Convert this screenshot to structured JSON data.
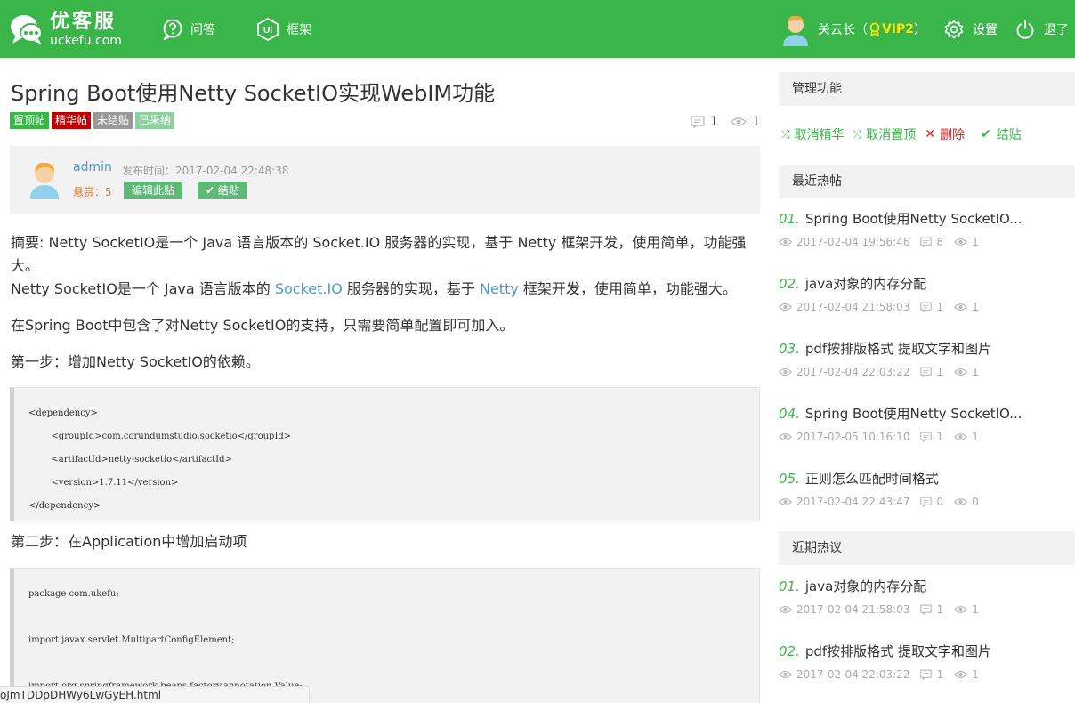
{
  "header": {
    "logo_cn": "优客服",
    "logo_en": "uckefu.com",
    "nav": [
      {
        "label": "问答",
        "icon": "question-icon"
      },
      {
        "label": "框架",
        "icon": "ui-icon"
      }
    ],
    "user_name": "关云长（",
    "vip": "VIP2",
    "user_close": "）",
    "settings_label": "设置",
    "logout_label": "退了"
  },
  "post": {
    "title": "Spring Boot使用Netty SocketIO实现WebIM功能",
    "tags": [
      {
        "label": "置顶帖",
        "color": "#39b54a"
      },
      {
        "label": "精华帖",
        "color": "#c00000"
      },
      {
        "label": "未结贴",
        "color": "#999999"
      },
      {
        "label": "已采纳",
        "color": "#5fb878"
      }
    ],
    "comments": "1",
    "views": "1",
    "author": "admin",
    "time": "发布时间：2017-02-04 22:48:38",
    "reward": "悬赏：5",
    "edit_label": "编辑此贴",
    "close_label": "结贴"
  },
  "content": {
    "summary_line1": "摘要: Netty SocketIO是一个 Java 语言版本的 Socket.IO 服务器的实现，基于 Netty 框架开发，使用简单，功能强",
    "summary_line2": "大。",
    "p1_a": "Netty SocketIO是一个 Java 语言版本的 ",
    "p1_link1": "Socket.IO",
    "p1_b": " 服务器的实现，基于 ",
    "p1_link2": "Netty",
    "p1_c": " 框架开发，使用简单，功能强大。",
    "p2": "在Spring Boot中包含了对Netty SocketIO的支持，只需要简单配置即可加入。",
    "p3": "第一步：增加Netty SocketIO的依赖。",
    "code1": [
      "<dependency>",
      "        <groupId>com.corundumstudio.socketio</groupId>",
      "        <artifactId>netty-socketio</artifactId>",
      "        <version>1.7.11</version>",
      "</dependency>"
    ],
    "p4": "第二步：在Application中增加启动项",
    "code2": [
      "package com.ukefu;",
      "import javax.servlet.MultipartConfigElement;",
      "import org.springframework.beans.factory.annotation.Value;"
    ]
  },
  "statusbar": "oJmTDDpDHWy6LwGyEH.html",
  "sidebar": {
    "admin_title": "管理功能",
    "admin_actions": [
      {
        "label": "取消精华",
        "color": "#39b54a"
      },
      {
        "label": "取消置顶",
        "color": "#39b54a"
      },
      {
        "label": "删除",
        "color": "#e02020"
      },
      {
        "label": "结贴",
        "color": "#39b54a"
      }
    ],
    "hot_title": "最近热帖",
    "hot": [
      {
        "num": "01.",
        "title": "Spring Boot使用Netty SocketIO...",
        "time": "2017-02-04 19:56:46",
        "comments": "8",
        "views": "1"
      },
      {
        "num": "02.",
        "title": "java对象的内存分配",
        "time": "2017-02-04 21:58:03",
        "comments": "1",
        "views": "1"
      },
      {
        "num": "03.",
        "title": "pdf按排版格式 提取文字和图片",
        "time": "2017-02-04 22:03:22",
        "comments": "1",
        "views": "1"
      },
      {
        "num": "04.",
        "title": "Spring Boot使用Netty SocketIO...",
        "time": "2017-02-05 10:16:10",
        "comments": "1",
        "views": "1"
      },
      {
        "num": "05.",
        "title": "正则怎么匹配时间格式",
        "time": "2017-02-04 22:43:47",
        "comments": "0",
        "views": "0"
      }
    ],
    "discuss_title": "近期热议",
    "discuss": [
      {
        "num": "01.",
        "title": "java对象的内存分配",
        "time": "2017-02-04 21:58:03",
        "comments": "1",
        "views": "1"
      },
      {
        "num": "02.",
        "title": "pdf按排版格式 提取文字和图片",
        "time": "2017-02-04 22:03:22",
        "comments": "1",
        "views": "1"
      }
    ]
  }
}
